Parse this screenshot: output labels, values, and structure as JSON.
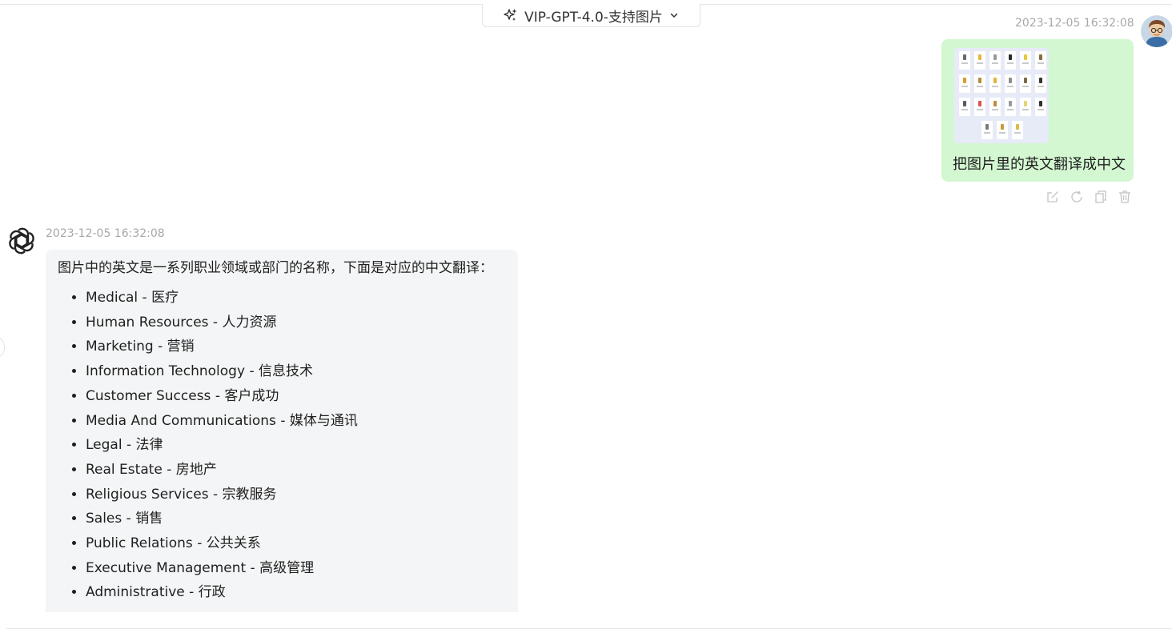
{
  "header": {
    "model_label": "VIP-GPT-4.0-支持图片",
    "model_icon": "sparkle-icon",
    "dropdown_icon": "chevron-down-icon"
  },
  "user_message": {
    "timestamp": "2023-12-05 16:32:08",
    "text": "把图片里的英文翻译成中文",
    "bubble_color": "#d3f7d1",
    "actions": [
      {
        "icon": "edit-icon"
      },
      {
        "icon": "refresh-icon"
      },
      {
        "icon": "copy-icon"
      },
      {
        "icon": "delete-icon"
      }
    ]
  },
  "bot_message": {
    "timestamp": "2023-12-05 16:32:08",
    "intro": "图片中的英文是一系列职业领域或部门的名称，下面是对应的中文翻译：",
    "items": [
      "Medical - 医疗",
      "Human Resources - 人力资源",
      "Marketing - 营销",
      "Information Technology - 信息技术",
      "Customer Success - 客户成功",
      "Media And Communications - 媒体与通讯",
      "Legal - 法律",
      "Real Estate - 房地产",
      "Religious Services - 宗教服务",
      "Sales - 销售",
      "Public Relations - 公共关系",
      "Executive Management - 高级管理",
      "Administrative - 行政"
    ],
    "bubble_color": "#f4f5f6",
    "avatar_icon": "openai-logo-icon"
  }
}
